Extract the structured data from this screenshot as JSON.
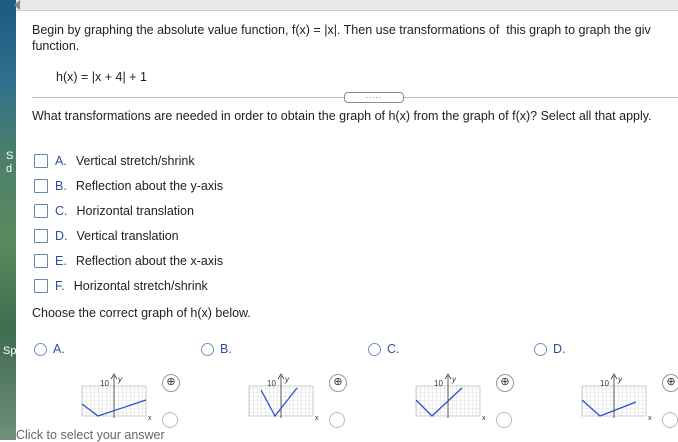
{
  "page": {
    "instruction_prefix": "Begin by graphing the absolute value function, f(x) = ",
    "instruction_abs": "|x|",
    "instruction_suffix": ". Then use transformations of  this graph to graph the giv",
    "instruction_line2": "function.",
    "formula": "h(x) = |x + 4| + 1",
    "handle_dots": ".....",
    "question": "What transformations are needed in order to obtain the graph of h(x) from the graph of f(x)? Select all that apply.",
    "options": [
      {
        "letter": "A.",
        "label": "Vertical stretch/shrink"
      },
      {
        "letter": "B.",
        "label": "Reflection about the y-axis"
      },
      {
        "letter": "C.",
        "label": "Horizontal translation"
      },
      {
        "letter": "D.",
        "label": "Vertical translation"
      },
      {
        "letter": "E.",
        "label": "Reflection about the x-axis"
      },
      {
        "letter": "F.",
        "label": "Horizontal stretch/shrink"
      }
    ],
    "choose_prompt": "Choose the correct graph of h(x) below.",
    "graph_choices": [
      {
        "letter": "A.",
        "tick": "10",
        "axis_y": "y",
        "axis_x": "x",
        "zoom": "⊕"
      },
      {
        "letter": "B.",
        "tick": "10",
        "axis_y": "y",
        "axis_x": "x",
        "zoom": "⊕"
      },
      {
        "letter": "C.",
        "tick": "10",
        "axis_y": "y",
        "axis_x": "x",
        "zoom": "⊕"
      },
      {
        "letter": "D.",
        "tick": "10",
        "axis_y": "y",
        "axis_x": "x",
        "zoom": "⊕"
      }
    ],
    "footer": "Click to select your answer"
  },
  "sidebar_fragments": [
    "S",
    "d",
    "Sp"
  ],
  "colors": {
    "accent": "#2c4f9e",
    "line": "#2a50d0",
    "grid": "#c7c7c7"
  }
}
